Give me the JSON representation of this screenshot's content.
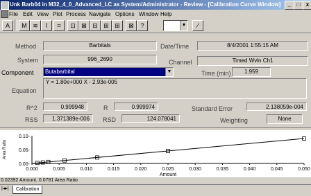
{
  "window": {
    "title": "Unk Barb04 in M32_4_0_Advanced_LC as System/Administrator - Review - [Calibration Curve Window]",
    "buttons": [
      "_",
      "□",
      "x"
    ]
  },
  "menu": [
    "File",
    "Edit",
    "View",
    "Plot",
    "Process",
    "Navigate",
    "Options",
    "Window",
    "Help"
  ],
  "toolbar": {
    "icons": [
      "A",
      "M",
      "≋",
      "⌇",
      "⌗",
      "⊡",
      "⊠",
      "⊟",
      "⊞",
      "⊞",
      "⊠",
      "?"
    ],
    "dropdown_value": ""
  },
  "form": {
    "method_label": "Method",
    "method_value": "Barbitals",
    "datetime_label": "Date/Time",
    "datetime_value": "8/4/2001 1:55:15 AM",
    "system_label": "System",
    "system_value": "996_2690",
    "channel_label": "Channel",
    "channel_value": "Timed Wvln Ch1",
    "component_label": "Component",
    "component_value": "Butabarbital",
    "time_label": "Time (min)",
    "time_value": "1.959",
    "equation_label": "Equation",
    "equation_value": "Y = 1.80e+000 X - 2.93e-005",
    "r2_label": "R^2",
    "r2_value": "0.999948",
    "r_label": "R",
    "r_value": "0.999974",
    "stderr_label": "Standard Error",
    "stderr_value": "2.138059e-004",
    "rss_label": "RSS",
    "rss_value": "1.371389e-006",
    "rsd_label": "RSD",
    "rsd_value": "124.078041",
    "weighting_label": "Weighting",
    "weighting_value": "None"
  },
  "chart_data": {
    "type": "scatter",
    "xlabel": "Amount",
    "ylabel": "Area Ratio",
    "xlim": [
      0.0,
      0.05
    ],
    "ylim": [
      0.0,
      0.1
    ],
    "xticks": [
      "0.000",
      "0.005",
      "0.010",
      "0.015",
      "0.020",
      "0.025",
      "0.030",
      "0.035",
      "0.040",
      "0.045",
      "0.050"
    ],
    "yticks": [
      "0.10-",
      "0.05-",
      "0.00-"
    ],
    "points": [
      [
        0.001,
        0.0018
      ],
      [
        0.002,
        0.0036
      ],
      [
        0.003,
        0.0054
      ],
      [
        0.006,
        0.0108
      ],
      [
        0.012,
        0.0216
      ],
      [
        0.025,
        0.045
      ],
      [
        0.05,
        0.09
      ]
    ],
    "fit_line": [
      [
        0.0,
        0.0
      ],
      [
        0.05,
        0.09
      ]
    ]
  },
  "status": {
    "text": "0.02392 Amount, 0.0781 Area Ratio"
  },
  "tabs": [
    "Calibration"
  ]
}
